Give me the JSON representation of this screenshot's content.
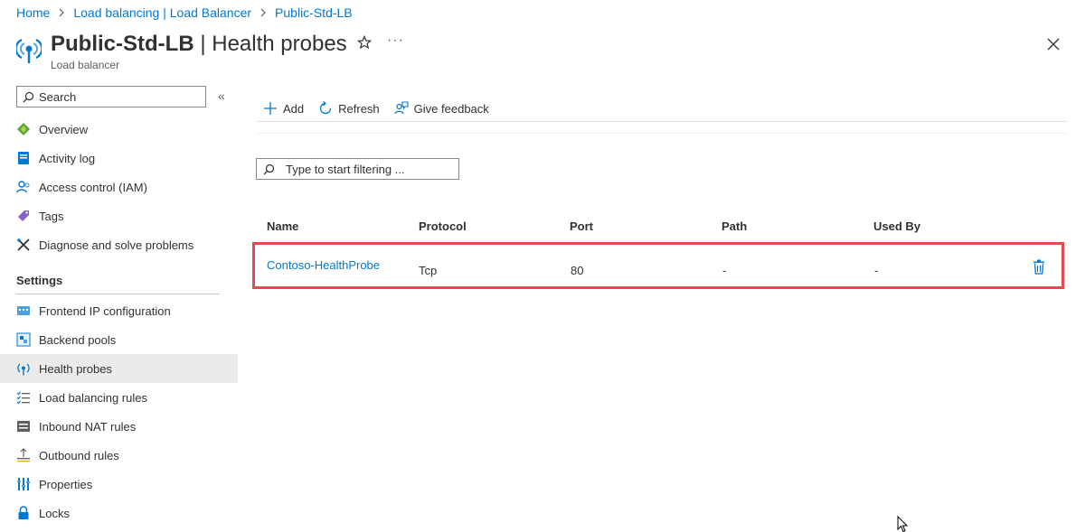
{
  "breadcrumb": [
    "Home",
    "Load balancing | Load Balancer",
    "Public-Std-LB"
  ],
  "header": {
    "resource_name": "Public-Std-LB",
    "separator": " | ",
    "page_name": "Health probes",
    "subtitle": "Load balancer"
  },
  "sidebar": {
    "search_placeholder": "Search",
    "items": [
      {
        "label": "Overview",
        "icon": "overview-icon"
      },
      {
        "label": "Activity log",
        "icon": "activity-log-icon"
      },
      {
        "label": "Access control (IAM)",
        "icon": "iam-icon"
      },
      {
        "label": "Tags",
        "icon": "tag-icon"
      },
      {
        "label": "Diagnose and solve problems",
        "icon": "wrench-icon"
      }
    ],
    "settings_title": "Settings",
    "settings_items": [
      {
        "label": "Frontend IP configuration",
        "icon": "frontend-ip-icon"
      },
      {
        "label": "Backend pools",
        "icon": "backend-pools-icon"
      },
      {
        "label": "Health probes",
        "icon": "health-probe-icon",
        "active": true
      },
      {
        "label": "Load balancing rules",
        "icon": "rules-list-icon"
      },
      {
        "label": "Inbound NAT rules",
        "icon": "nat-icon"
      },
      {
        "label": "Outbound rules",
        "icon": "outbound-icon"
      },
      {
        "label": "Properties",
        "icon": "properties-icon"
      },
      {
        "label": "Locks",
        "icon": "lock-icon"
      }
    ]
  },
  "toolbar": {
    "add": "Add",
    "refresh": "Refresh",
    "feedback": "Give feedback"
  },
  "filter": {
    "placeholder": "Type to start filtering ..."
  },
  "table": {
    "columns": [
      "Name",
      "Protocol",
      "Port",
      "Path",
      "Used By"
    ],
    "rows": [
      {
        "name": "Contoso-HealthProbe",
        "protocol": "Tcp",
        "port": "80",
        "path": "-",
        "used_by": "-"
      }
    ]
  },
  "colors": {
    "accent": "#0078d4",
    "highlight_border": "#e5484d",
    "active_nav": "#edebe9"
  }
}
